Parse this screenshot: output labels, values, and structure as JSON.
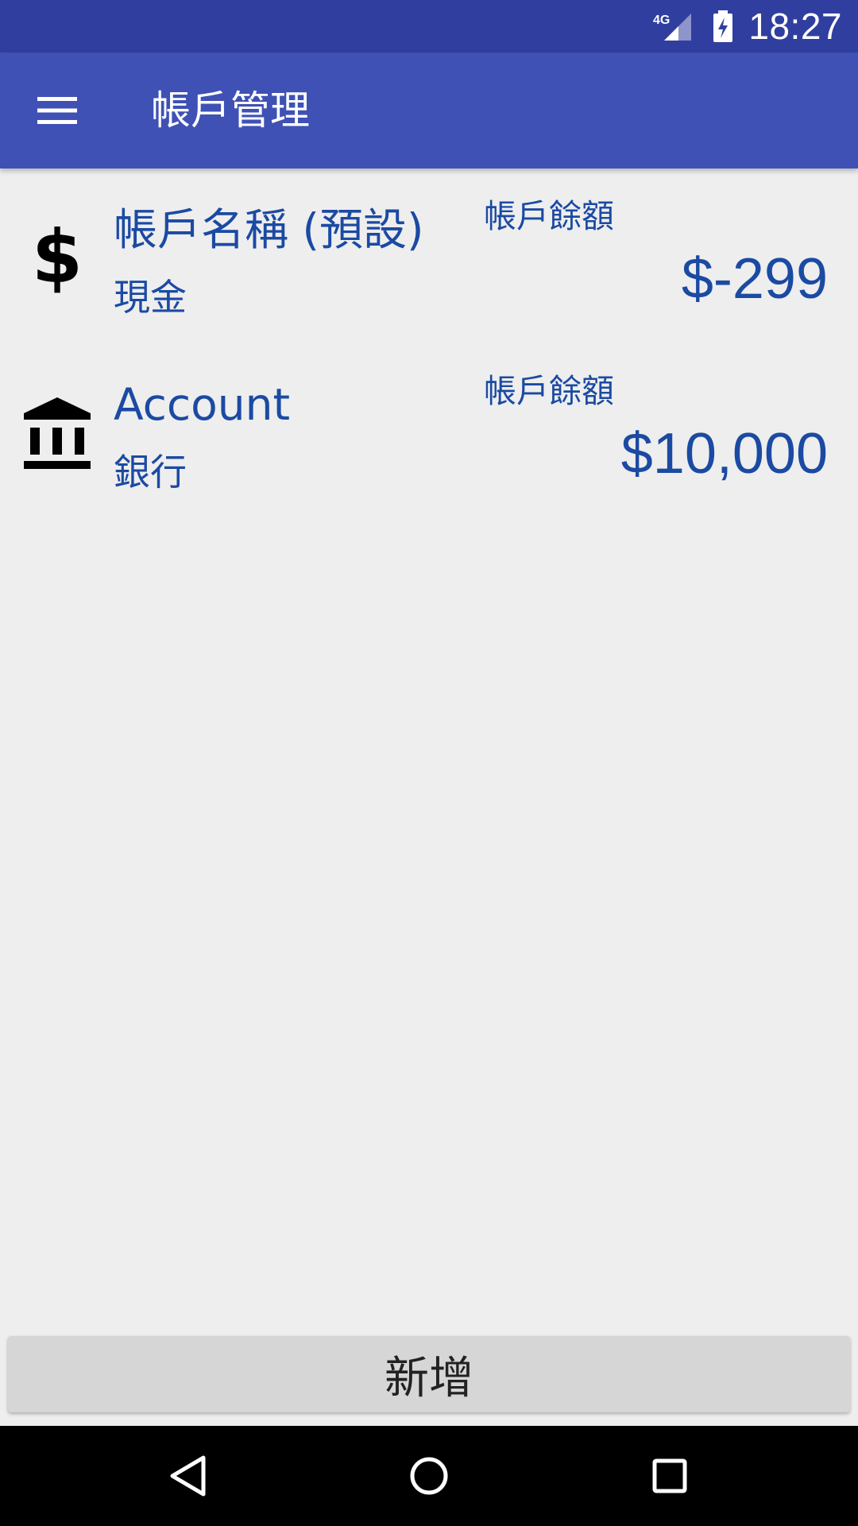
{
  "status_bar": {
    "time": "18:27",
    "network": "4G",
    "icons": [
      "signal-icon",
      "battery-charging-icon"
    ]
  },
  "app_bar": {
    "title": "帳戶管理",
    "menu_icon": "menu-icon"
  },
  "accounts": [
    {
      "icon": "dollar-icon",
      "name": "帳戶名稱 (預設)",
      "type": "現金",
      "balance_label": "帳戶餘額",
      "balance": "$-299"
    },
    {
      "icon": "bank-icon",
      "name": "Account",
      "type": "銀行",
      "balance_label": "帳戶餘額",
      "balance": "$10,000"
    }
  ],
  "add_button": {
    "label": "新增"
  },
  "colors": {
    "status_bar": "#303f9f",
    "app_bar": "#3f51b5",
    "accent_text": "#1b4aa3",
    "background": "#eeeeee"
  },
  "nav_bar": {
    "icons": [
      "back-icon",
      "home-icon",
      "recents-icon"
    ]
  }
}
